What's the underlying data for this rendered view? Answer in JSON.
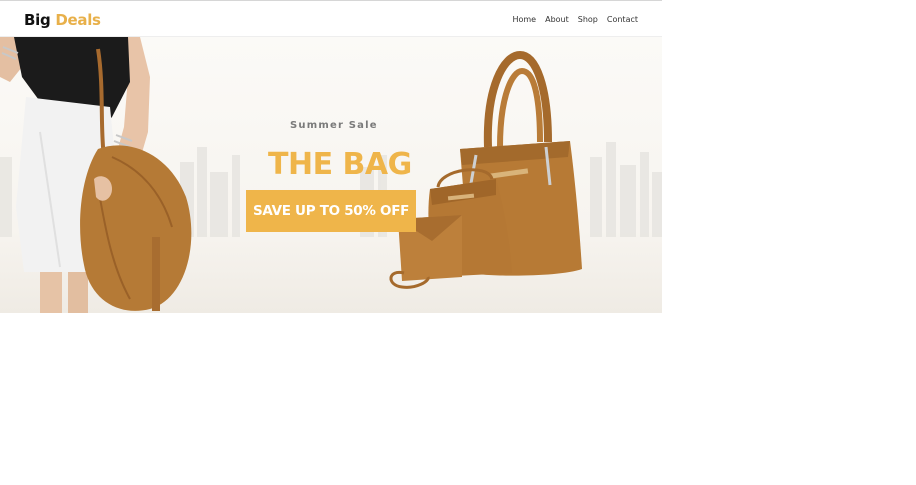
{
  "brand": {
    "first": "Big",
    "second": "Deals"
  },
  "nav": {
    "items": [
      "Home",
      "About",
      "Shop",
      "Contact"
    ]
  },
  "hero": {
    "subtitle": "Summer Sale",
    "title": "THE BAG",
    "cta": "SAVE UP TO 50% OFF"
  },
  "colors": {
    "accent": "#efb54a",
    "bag": "#b57a36"
  }
}
